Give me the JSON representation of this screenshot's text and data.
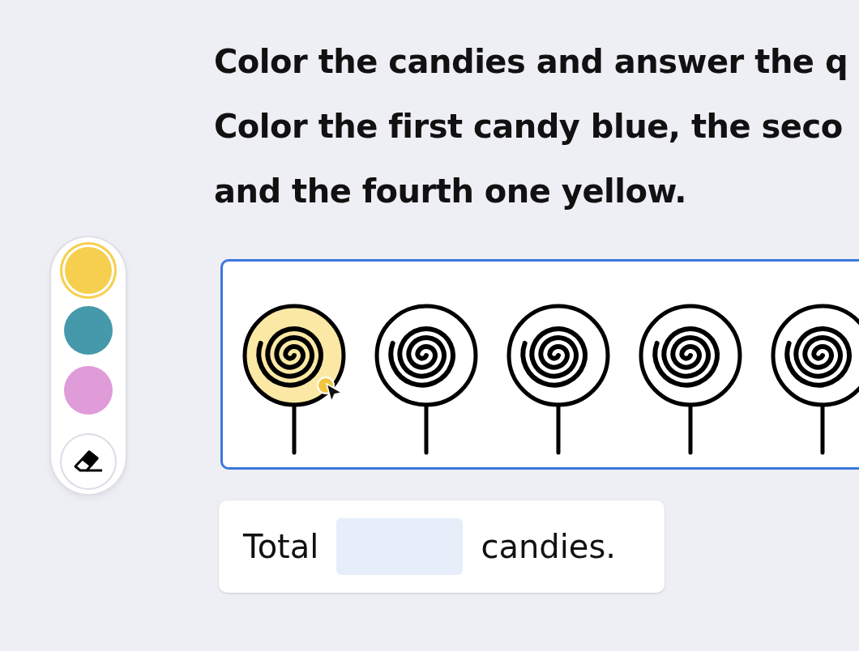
{
  "task": {
    "title": "Color the candies and answer the q",
    "lines": [
      "Color the first candy blue, the seco",
      "and the fourth one yellow."
    ]
  },
  "palette": [
    {
      "color": "#f6cf4e",
      "selected": true
    },
    {
      "color": "#4599ab",
      "selected": false
    },
    {
      "color": "#e09bd9",
      "selected": false
    }
  ],
  "candies": [
    {
      "colored": true,
      "color": "#fbe8a4"
    },
    {
      "colored": false
    },
    {
      "colored": false
    },
    {
      "colored": false
    },
    {
      "colored": false
    }
  ],
  "answer": {
    "before": "Total",
    "after": "candies."
  }
}
